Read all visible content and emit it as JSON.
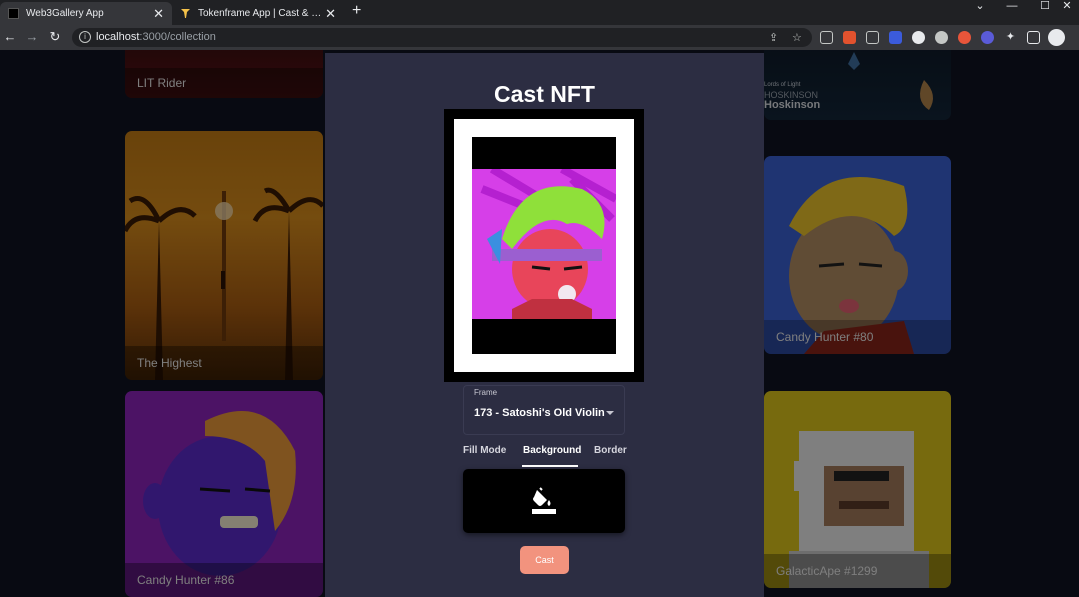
{
  "browser": {
    "tabs": [
      {
        "title": "Web3Gallery App",
        "active": true
      },
      {
        "title": "Tokenframe App | Cast & Display",
        "active": false
      }
    ],
    "url_host": "localhost",
    "url_path": ":3000/collection"
  },
  "gallery": {
    "cards": [
      {
        "name": "LIT Rider"
      },
      {
        "name": "The Highest"
      },
      {
        "name": "Candy Hunter #86"
      },
      {
        "name": "Hoskinson",
        "subtitle": "HOSKINSON",
        "brand": "Lords of Light"
      },
      {
        "name": "Candy Hunter #80"
      },
      {
        "name": "GalacticApe #1299"
      }
    ]
  },
  "modal": {
    "title": "Cast NFT",
    "frame_label": "Frame",
    "frame_value": "173 - Satoshi's Old Violin",
    "tabs": [
      "Fill Mode",
      "Background",
      "Border"
    ],
    "active_tab": "Background",
    "background_color": "#000000",
    "cast_label": "Cast"
  },
  "colors": {
    "accent": "#f2937e",
    "modal_bg": "#2c2d42",
    "page_bg": "#101322"
  }
}
